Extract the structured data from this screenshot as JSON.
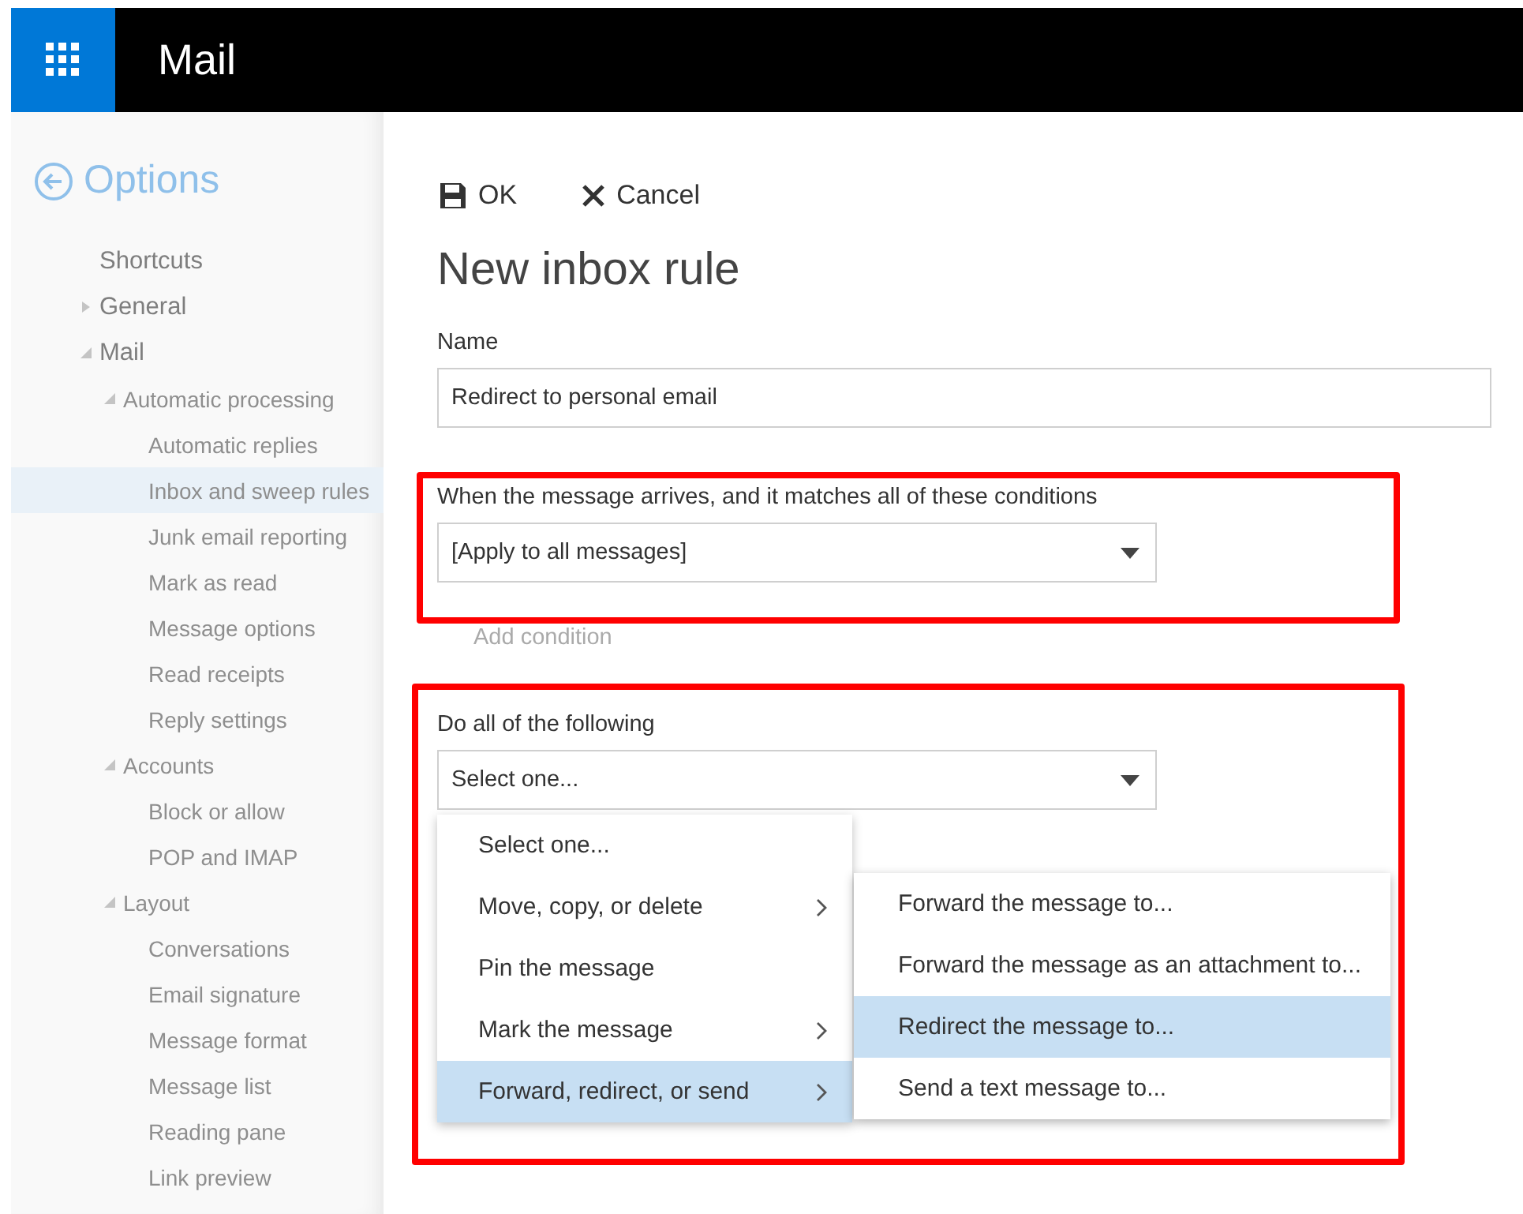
{
  "app_bar": {
    "title": "Mail"
  },
  "sidebar": {
    "title": "Options",
    "items": [
      {
        "label": "Shortcuts",
        "selected": false
      },
      {
        "label": "General",
        "selected": false,
        "expanded": false
      },
      {
        "label": "Mail",
        "selected": false,
        "expanded": true,
        "children": [
          {
            "label": "Automatic processing",
            "selected": false,
            "expanded": true,
            "children": [
              {
                "label": "Automatic replies",
                "selected": false
              },
              {
                "label": "Inbox and sweep rules",
                "selected": true
              },
              {
                "label": "Junk email reporting",
                "selected": false
              },
              {
                "label": "Mark as read",
                "selected": false
              },
              {
                "label": "Message options",
                "selected": false
              },
              {
                "label": "Read receipts",
                "selected": false
              },
              {
                "label": "Reply settings",
                "selected": false
              }
            ]
          },
          {
            "label": "Accounts",
            "selected": false,
            "expanded": true,
            "children": [
              {
                "label": "Block or allow",
                "selected": false
              },
              {
                "label": "POP and IMAP",
                "selected": false
              }
            ]
          },
          {
            "label": "Layout",
            "selected": false,
            "expanded": true,
            "children": [
              {
                "label": "Conversations",
                "selected": false
              },
              {
                "label": "Email signature",
                "selected": false
              },
              {
                "label": "Message format",
                "selected": false
              },
              {
                "label": "Message list",
                "selected": false
              },
              {
                "label": "Reading pane",
                "selected": false
              },
              {
                "label": "Link preview",
                "selected": false
              }
            ]
          }
        ]
      }
    ]
  },
  "toolbar": {
    "ok": "OK",
    "cancel": "Cancel"
  },
  "heading": "New inbox rule",
  "name_field": {
    "label": "Name",
    "value": "Redirect to personal email"
  },
  "conditions": {
    "label": "When the message arrives, and it matches all of these conditions",
    "value": "[Apply to all messages]",
    "add_link": "Add condition"
  },
  "actions": {
    "label": "Do all of the following",
    "value": "Select one...",
    "menu": [
      {
        "label": "Select one...",
        "highlighted": false,
        "submenu": false
      },
      {
        "label": "Move, copy, or delete",
        "highlighted": false,
        "submenu": true
      },
      {
        "label": "Pin the message",
        "highlighted": false,
        "submenu": false
      },
      {
        "label": "Mark the message",
        "highlighted": false,
        "submenu": true
      },
      {
        "label": "Forward, redirect, or send",
        "highlighted": true,
        "submenu": true
      }
    ],
    "submenu": [
      {
        "label": "Forward the message to...",
        "highlighted": false
      },
      {
        "label": "Forward the message as an attachment to...",
        "highlighted": false
      },
      {
        "label": "Redirect the message to...",
        "highlighted": true
      },
      {
        "label": "Send a text message to...",
        "highlighted": false
      }
    ]
  }
}
